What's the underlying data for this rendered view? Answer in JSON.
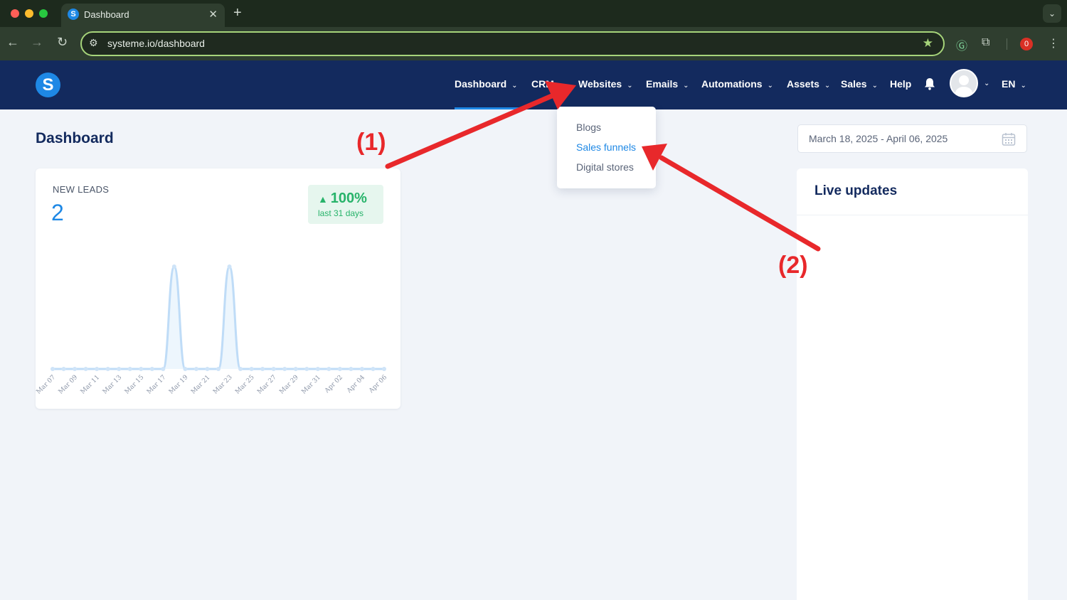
{
  "browser": {
    "tab_title": "Dashboard",
    "tab_favicon": "S",
    "url": "systeme.io/dashboard",
    "extension_badge": "0"
  },
  "header": {
    "logo_letter": "S",
    "nav": [
      {
        "label": "Dashboard"
      },
      {
        "label": "CRM"
      },
      {
        "label": "Websites"
      },
      {
        "label": "Emails"
      },
      {
        "label": "Automations"
      },
      {
        "label": "Assets"
      },
      {
        "label": "Sales"
      },
      {
        "label": "Help"
      }
    ],
    "language": "EN"
  },
  "websites_menu": {
    "items": [
      {
        "label": "Blogs"
      },
      {
        "label": "Sales funnels"
      },
      {
        "label": "Digital stores"
      }
    ],
    "highlighted": "Sales funnels"
  },
  "page": {
    "title": "Dashboard",
    "date_range": "March 18, 2025 - April 06, 2025"
  },
  "leads_card": {
    "label": "NEW LEADS",
    "value": "2",
    "change": "100%",
    "change_period": "last 31 days"
  },
  "live_updates": {
    "title": "Live updates"
  },
  "annotations": [
    {
      "label": "(1)"
    },
    {
      "label": "(2)"
    }
  ],
  "colors": {
    "header_bg": "#132a5e",
    "accent": "#1e88e5",
    "positive": "#27b36a",
    "annotation": "#e8282b"
  },
  "chart_data": {
    "type": "area",
    "x": [
      "Mar 07",
      "Mar 08",
      "Mar 09",
      "Mar 10",
      "Mar 11",
      "Mar 12",
      "Mar 13",
      "Mar 14",
      "Mar 15",
      "Mar 16",
      "Mar 17",
      "Mar 18",
      "Mar 19",
      "Mar 20",
      "Mar 21",
      "Mar 22",
      "Mar 23",
      "Mar 24",
      "Mar 25",
      "Mar 26",
      "Mar 27",
      "Mar 28",
      "Mar 29",
      "Mar 30",
      "Mar 31",
      "Apr 01",
      "Apr 02",
      "Apr 03",
      "Apr 04",
      "Apr 05",
      "Apr 06"
    ],
    "tick_labels": [
      "Mar 07",
      "Mar 09",
      "Mar 11",
      "Mar 13",
      "Mar 15",
      "Mar 17",
      "Mar 19",
      "Mar 21",
      "Mar 23",
      "Mar 25",
      "Mar 27",
      "Mar 29",
      "Mar 31",
      "Apr 02",
      "Apr 04",
      "Apr 06"
    ],
    "values": [
      0,
      0,
      0,
      0,
      0,
      0,
      0,
      0,
      0,
      0,
      0,
      1,
      0,
      0,
      0,
      0,
      1,
      0,
      0,
      0,
      0,
      0,
      0,
      0,
      0,
      0,
      0,
      0,
      0,
      0,
      0
    ],
    "ylim": [
      0,
      1
    ],
    "grid": false,
    "legend": "none"
  }
}
